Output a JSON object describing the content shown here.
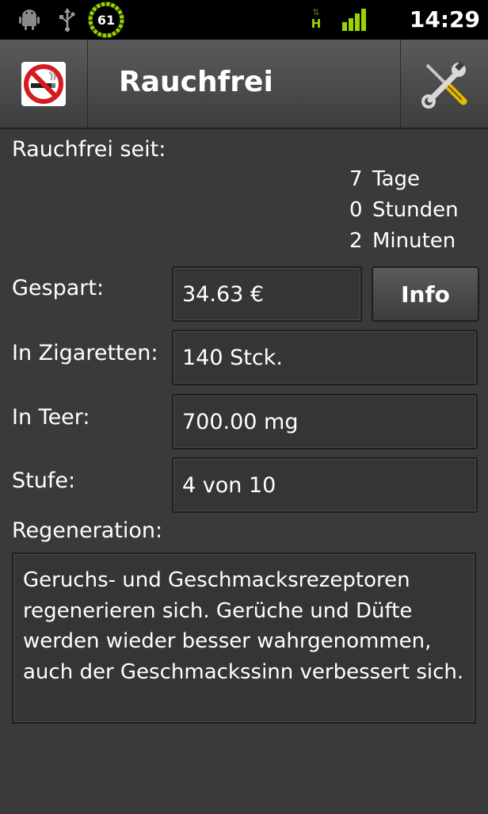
{
  "statusbar": {
    "battery_level": "61",
    "network_type": "H",
    "time": "14:29",
    "icons": [
      "android-icon",
      "usb-icon",
      "battery-icon",
      "data-arrows-icon",
      "signal-icon"
    ]
  },
  "actionbar": {
    "title": "Rauchfrei",
    "logo_icon": "no-smoking-icon",
    "settings_icon": "tools-icon"
  },
  "smoke_free": {
    "label": "Rauchfrei seit:",
    "days_value": "7",
    "days_unit": "Tage",
    "hours_value": "0",
    "hours_unit": "Stunden",
    "minutes_value": "2",
    "minutes_unit": "Minuten"
  },
  "saved": {
    "label": "Gespart:",
    "value": "34.63 €"
  },
  "info_button": "Info",
  "cigarettes": {
    "label": "In Zigaretten:",
    "value": "140 Stck."
  },
  "tar": {
    "label": "In Teer:",
    "value": "700.00 mg"
  },
  "level": {
    "label": "Stufe:",
    "value": "4 von 10"
  },
  "regeneration": {
    "label": "Regeneration:",
    "text": "Geruchs- und Geschmacksrezeptoren regenerieren sich. Gerüche und Düfte werden wieder besser wahrgenommen, auch der Geschmackssinn verbessert sich."
  },
  "colors": {
    "background": "#3a3a3a",
    "statusbar": "#000000",
    "accent_green": "#9bd400",
    "no_smoking_red": "#d71920"
  }
}
